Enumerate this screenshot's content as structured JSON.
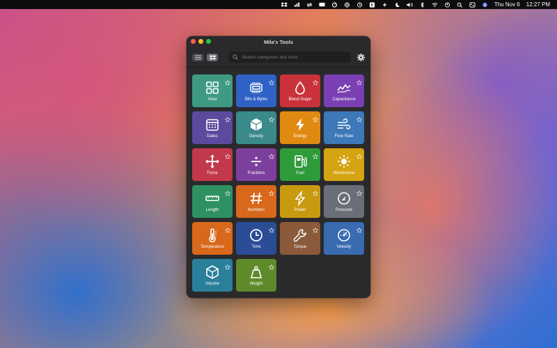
{
  "menubar": {
    "date": "Thu Nov 6",
    "time": "12:27 PM",
    "icons": [
      "dropbox-icon",
      "music-icon",
      "sync-icon",
      "display-icon",
      "speedometer-icon",
      "globe-icon",
      "clock-icon",
      "b-app-icon",
      "bolt-icon",
      "moon-icon",
      "volume-icon",
      "bluetooth-icon",
      "wifi-icon",
      "user-icon",
      "search-icon",
      "control-center-icon",
      "siri-icon"
    ]
  },
  "window": {
    "title": "Mila's Tools",
    "search_placeholder": "Search categories and units"
  },
  "tiles": [
    {
      "label": "Area",
      "color": "#3f9a84",
      "icon": "area-icon"
    },
    {
      "label": "Bits & Bytes",
      "color": "#2f62c4",
      "icon": "chip-icon"
    },
    {
      "label": "Blood Sugar",
      "color": "#c9323a",
      "icon": "drop-icon"
    },
    {
      "label": "Capacitance",
      "color": "#7a3fb2",
      "icon": "wave-icon"
    },
    {
      "label": "Dates",
      "color": "#5b4a9e",
      "icon": "calendar-icon"
    },
    {
      "label": "Density",
      "color": "#3a8a8a",
      "icon": "cube-icon"
    },
    {
      "label": "Energy",
      "color": "#e08a12",
      "icon": "bolt-icon"
    },
    {
      "label": "Flow Rate",
      "color": "#3d78b8",
      "icon": "wind-icon"
    },
    {
      "label": "Force",
      "color": "#c2384c",
      "icon": "move-icon"
    },
    {
      "label": "Fractions",
      "color": "#7d3f9c",
      "icon": "divide-icon"
    },
    {
      "label": "Fuel",
      "color": "#2f9a3a",
      "icon": "fuel-icon"
    },
    {
      "label": "Illuminance",
      "color": "#d4a412",
      "icon": "sun-icon"
    },
    {
      "label": "Length",
      "color": "#2f9062",
      "icon": "ruler-icon"
    },
    {
      "label": "Numbers",
      "color": "#d8681c",
      "icon": "hash-icon"
    },
    {
      "label": "Power",
      "color": "#c89a10",
      "icon": "power-bolt-icon"
    },
    {
      "label": "Pressure",
      "color": "#6a6e78",
      "icon": "gauge-icon"
    },
    {
      "label": "Temperature",
      "color": "#d8681a",
      "icon": "thermometer-icon"
    },
    {
      "label": "Time",
      "color": "#2a4d96",
      "icon": "clock-icon"
    },
    {
      "label": "Torque",
      "color": "#8a5a3a",
      "icon": "wrench-icon"
    },
    {
      "label": "Velocity",
      "color": "#3a6ab0",
      "icon": "speedometer-icon"
    },
    {
      "label": "Volume",
      "color": "#2a7f9a",
      "icon": "box-icon"
    },
    {
      "label": "Weight",
      "color": "#5f8a2a",
      "icon": "weight-icon"
    }
  ]
}
